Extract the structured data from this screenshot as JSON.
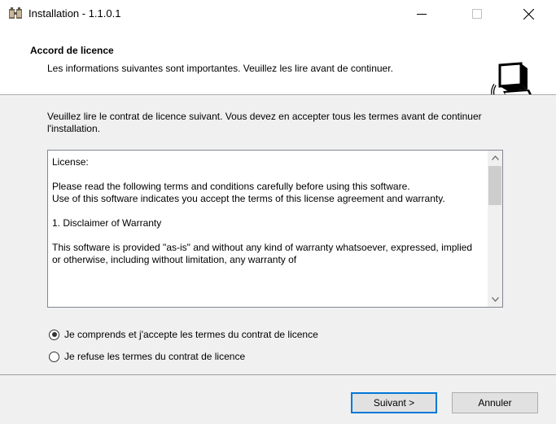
{
  "window": {
    "title": "Installation - 1.1.0.1",
    "icon": "installer-icon",
    "controls": [
      "minimize-icon",
      "maximize-icon",
      "close-icon"
    ]
  },
  "header": {
    "title": "Accord de licence",
    "subtitle": "Les informations suivantes sont importantes. Veuillez les lire avant de continuer.",
    "icon": "setup-computer-icon"
  },
  "intro": "Veuillez lire le contrat de licence suivant. Vous devez en accepter tous les termes avant de continuer l'installation.",
  "license": {
    "paragraphs": [
      "License:",
      "Please read the following terms and conditions carefully before using this software.\nUse of this software indicates you accept the terms of this license agreement and warranty.",
      "1. Disclaimer of Warranty",
      "This software is provided \"as-is\" and without any kind of warranty whatsoever, expressed,  implied or otherwise, including without limitation, any warranty of"
    ]
  },
  "options": {
    "accept": "Je comprends et j'accepte les termes du contrat de licence",
    "refuse": "Je refuse les termes du contrat de licence",
    "selected": "accept"
  },
  "buttons": {
    "next": "Suivant >",
    "cancel": "Annuler"
  },
  "colors": {
    "focus_border": "#0078d7",
    "panel_bg": "#f0f0f0"
  }
}
